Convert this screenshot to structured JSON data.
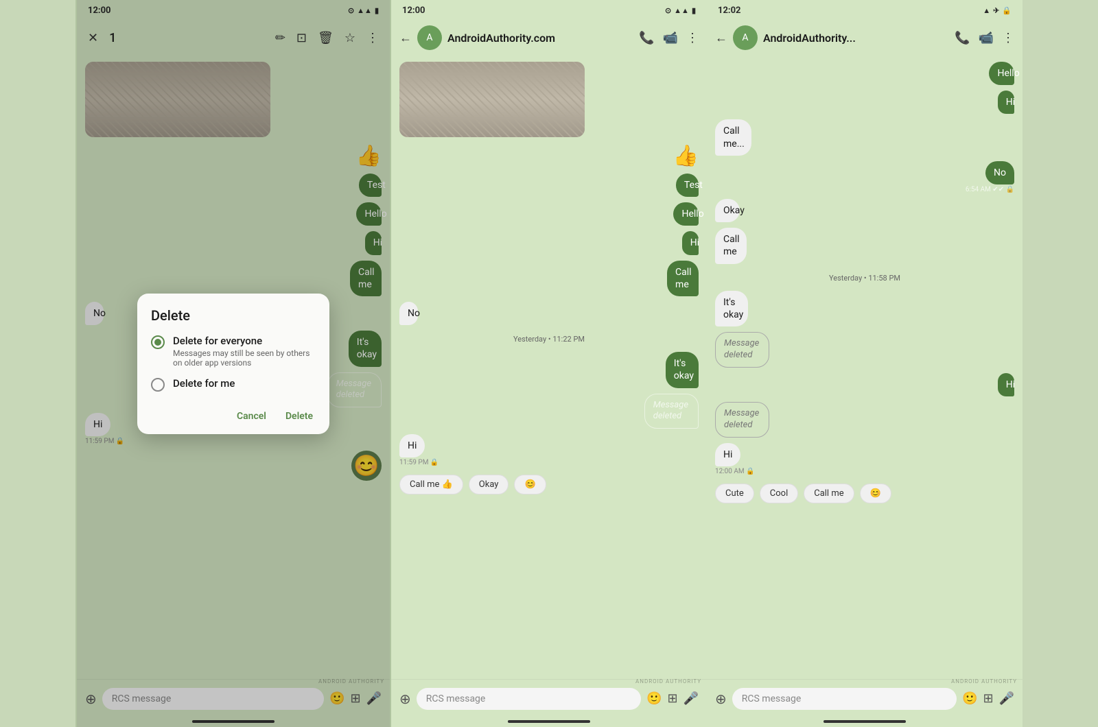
{
  "frame1": {
    "status": {
      "time": "12:00",
      "icons": "⊙ ☁ ▲▲ 🔋"
    },
    "toolbar": {
      "close_icon": "✕",
      "count": "1",
      "edit_icon": "✏",
      "copy_icon": "⊡",
      "delete_icon": "🗑",
      "star_icon": "☆",
      "more_icon": "⋮"
    },
    "messages": [
      {
        "type": "image",
        "sender": "received"
      },
      {
        "type": "emoji",
        "content": "👍",
        "sender": "sent"
      },
      {
        "type": "text",
        "content": "Test",
        "sender": "sent"
      },
      {
        "type": "text",
        "content": "Hello",
        "sender": "sent"
      },
      {
        "type": "text",
        "content": "Hi",
        "sender": "sent"
      },
      {
        "type": "text",
        "content": "Call me",
        "sender": "sent"
      },
      {
        "type": "text",
        "content": "No",
        "sender": "received"
      },
      {
        "type": "text",
        "content": "It's okay",
        "sender": "sent"
      },
      {
        "type": "deleted",
        "content": "Message deleted",
        "sender": "sent"
      },
      {
        "type": "text",
        "content": "Hi",
        "sender": "received",
        "time": "11:59 PM",
        "lock": true
      },
      {
        "type": "emoji",
        "content": "😊",
        "sender": "sent"
      }
    ],
    "dialog": {
      "title": "Delete",
      "option1_label": "Delete for everyone",
      "option1_sub": "Messages may still be seen by others on older app versions",
      "option2_label": "Delete for me",
      "cancel": "Cancel",
      "delete": "Delete"
    },
    "input": {
      "placeholder": "RCS message"
    },
    "watermark": "ANDROID AUTHORITY"
  },
  "frame2": {
    "status": {
      "time": "12:00",
      "icons": "⊙ ☁ ▲▲ 🔋"
    },
    "toolbar": {
      "back_icon": "←",
      "name": "AndroidAuthority.com",
      "phone_icon": "📞",
      "video_icon": "📹",
      "more_icon": "⋮"
    },
    "messages": [
      {
        "type": "image",
        "sender": "received"
      },
      {
        "type": "emoji",
        "content": "👍",
        "sender": "sent"
      },
      {
        "type": "text",
        "content": "Test",
        "sender": "sent"
      },
      {
        "type": "text",
        "content": "Hello",
        "sender": "sent"
      },
      {
        "type": "text",
        "content": "Hi",
        "sender": "sent"
      },
      {
        "type": "text",
        "content": "Call me",
        "sender": "sent"
      },
      {
        "type": "text",
        "content": "No",
        "sender": "received"
      },
      {
        "type": "date",
        "content": "Yesterday • 11:22 PM"
      },
      {
        "type": "text",
        "content": "It's okay",
        "sender": "sent"
      },
      {
        "type": "deleted",
        "content": "Message deleted",
        "sender": "sent"
      },
      {
        "type": "text",
        "content": "Hi",
        "sender": "received",
        "time": "11:59 PM",
        "lock": true
      }
    ],
    "quick_replies": [
      "Call me 👍",
      "Okay",
      "😊"
    ],
    "input": {
      "placeholder": "RCS message"
    },
    "watermark": "ANDROID AUTHORITY"
  },
  "frame3": {
    "status": {
      "time": "12:02",
      "icons": "📶 ✈ 🔒"
    },
    "toolbar": {
      "back_icon": "←",
      "name": "AndroidAuthority...",
      "phone_icon": "📞",
      "video_icon": "📹",
      "more_icon": "⋮"
    },
    "messages": [
      {
        "type": "text",
        "content": "Hello",
        "sender": "sent"
      },
      {
        "type": "text",
        "content": "Hi",
        "sender": "sent"
      },
      {
        "type": "text",
        "content": "Call me...",
        "sender": "received"
      },
      {
        "type": "text",
        "content": "No",
        "sender": "sent",
        "time": "6:54 AM",
        "check": true,
        "lock": true
      },
      {
        "type": "text",
        "content": "Okay",
        "sender": "received"
      },
      {
        "type": "text",
        "content": "Call me",
        "sender": "received"
      },
      {
        "type": "date",
        "content": "Yesterday • 11:58 PM"
      },
      {
        "type": "text",
        "content": "It's okay",
        "sender": "received"
      },
      {
        "type": "deleted",
        "content": "Message deleted",
        "sender": "received"
      },
      {
        "type": "text",
        "content": "Hi",
        "sender": "sent"
      },
      {
        "type": "deleted",
        "content": "Message deleted",
        "sender": "received"
      },
      {
        "type": "text",
        "content": "Hi",
        "sender": "received",
        "time": "12:00 AM",
        "lock": true
      }
    ],
    "quick_replies": [
      "Cute",
      "Cool",
      "Call me",
      "😊"
    ],
    "input": {
      "placeholder": "RCS message"
    },
    "watermark": "ANDROID AUTHORITY"
  }
}
